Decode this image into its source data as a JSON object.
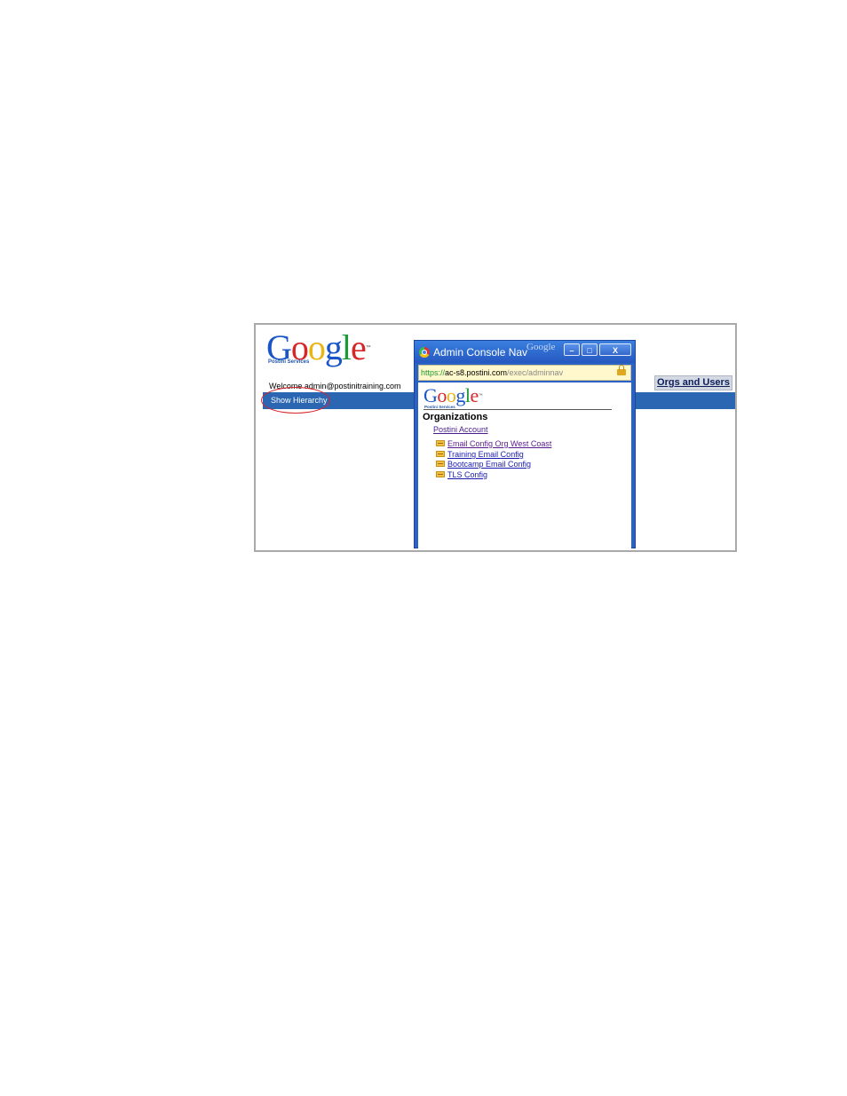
{
  "background_page": {
    "logo": {
      "letters": [
        "G",
        "o",
        "o",
        "g",
        "l",
        "e"
      ],
      "trademark": "™",
      "subtitle": "Postini Services"
    },
    "welcome_text": "Welcome admin@postinitraining.com",
    "show_hierarchy_label": "Show Hierarchy",
    "orgs_tab_label": "Orgs and Users",
    "colors": {
      "nav_bar": "#2a66b2",
      "highlight_ellipse": "#d9222a"
    }
  },
  "popup": {
    "title": "Admin Console Nav",
    "title_brand": "Google",
    "buttons": {
      "minimize": "–",
      "maximize": "□",
      "close": "X"
    },
    "address": {
      "scheme": "https://",
      "host": "ac-s8.postini.com",
      "path": "/exec/adminnav"
    },
    "logo": {
      "letters": [
        "G",
        "o",
        "o",
        "g",
        "l",
        "e"
      ],
      "trademark": "™",
      "subtitle": "Postini Services"
    },
    "heading": "Organizations",
    "root_org": "Postini Account",
    "orgs": [
      {
        "label": "Email Config Org West Coast",
        "icon": "envelope-icon"
      },
      {
        "label": "Training Email Config",
        "icon": "envelope-icon"
      },
      {
        "label": "Bootcamp Email Config",
        "icon": "envelope-icon"
      },
      {
        "label": "TLS Config",
        "icon": "envelope-icon"
      }
    ]
  }
}
